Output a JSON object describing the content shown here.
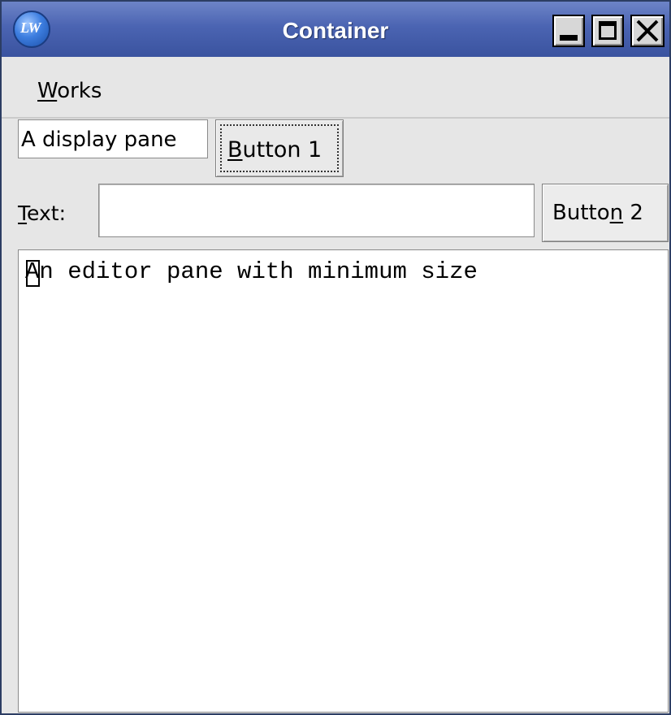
{
  "window": {
    "title": "Container",
    "app_icon": {
      "name": "lw-app-icon",
      "text": "LW"
    },
    "controls": {
      "minimize": "minimize-icon",
      "maximize": "maximize-icon",
      "close": "close-icon"
    }
  },
  "menubar": {
    "items": [
      {
        "label_mnemonic": "W",
        "label_rest": "orks"
      }
    ]
  },
  "row1": {
    "display_pane_text": "A display pane",
    "button1": {
      "mnemonic": "B",
      "rest": "utton 1"
    }
  },
  "row2": {
    "label_mnemonic": "T",
    "label_rest": "ext:",
    "text_value": "",
    "button2": {
      "pre": "Butto",
      "mnemonic": "n",
      "rest": " 2"
    }
  },
  "editor": {
    "content": "An editor pane with minimum size"
  },
  "colors": {
    "titlebar": "#4b64b2",
    "window_bg": "#e6e6e6",
    "field_bg": "#ffffff"
  }
}
